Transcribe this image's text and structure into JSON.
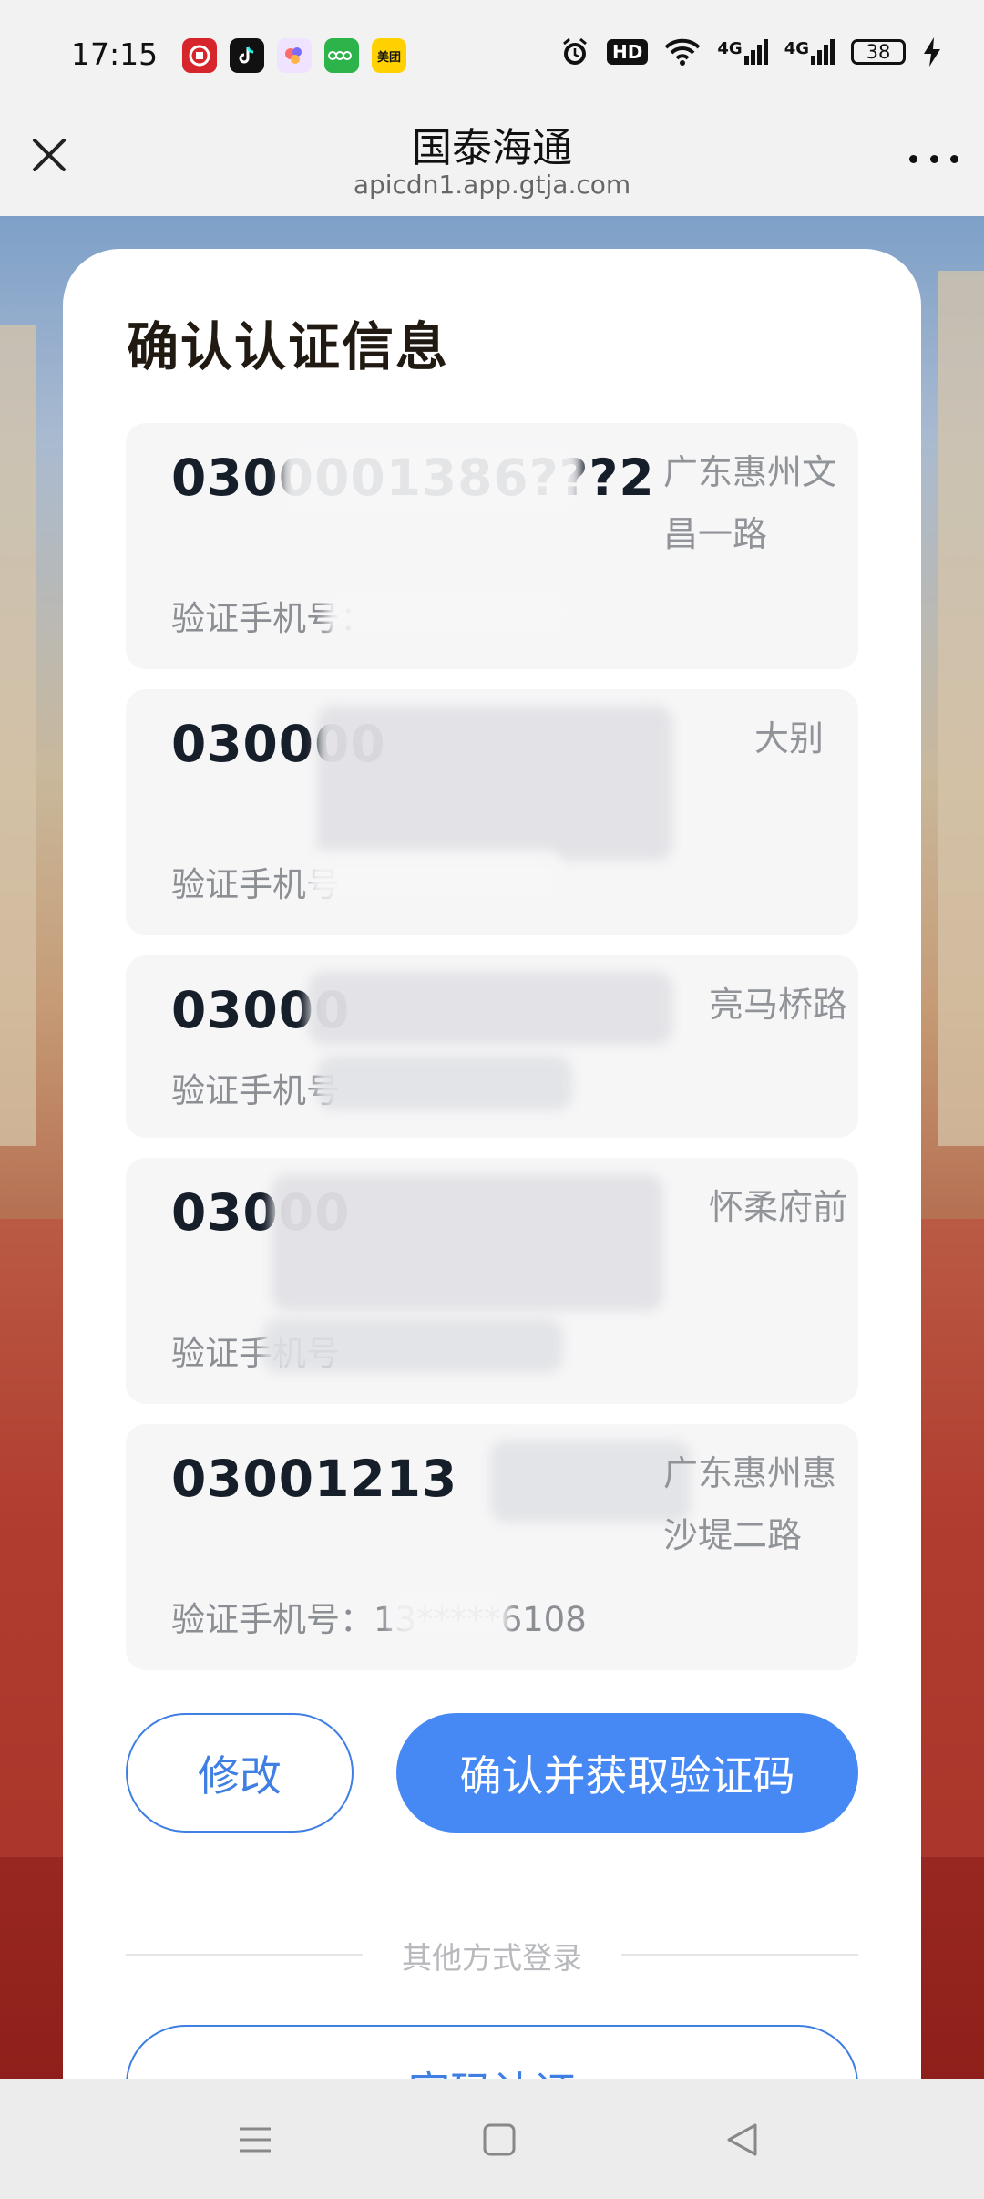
{
  "status_bar": {
    "time": "17:15",
    "app_icons": [
      "app-icon-1",
      "tiktok-icon",
      "app-icon-3",
      "oppo-icon",
      "meituan-icon"
    ],
    "meituan_label": "美团",
    "battery": "38",
    "hd_label": "HD",
    "signal_labels": [
      "4G",
      "4G"
    ]
  },
  "header": {
    "title": "国泰海通",
    "url": "apicdn1.app.gtja.com"
  },
  "card": {
    "title": "确认认证信息",
    "accounts": [
      {
        "number": "0300001386???2",
        "branch": "广东惠州文昌一路",
        "phone_label": "验证手机号："
      },
      {
        "number": "030000",
        "branch": "大别",
        "phone_label": "验证手机号"
      },
      {
        "number": "03000",
        "branch": "亮马桥路",
        "phone_label": "验证手机号"
      },
      {
        "number": "03000",
        "branch": "怀柔府前",
        "phone_label": "验证手机号"
      },
      {
        "number": "03001213",
        "branch": "广东惠州惠沙堤二路",
        "phone_label": "验证手机号：",
        "phone_value": "13*****6108"
      }
    ],
    "modify_button": "修改",
    "confirm_button": "确认并获取验证码",
    "other_login_label": "其他方式登录",
    "password_button": "密码认证"
  },
  "colors": {
    "primary": "#4688f4",
    "card_bg": "#ffffff",
    "row_bg": "#f6f6f7"
  }
}
